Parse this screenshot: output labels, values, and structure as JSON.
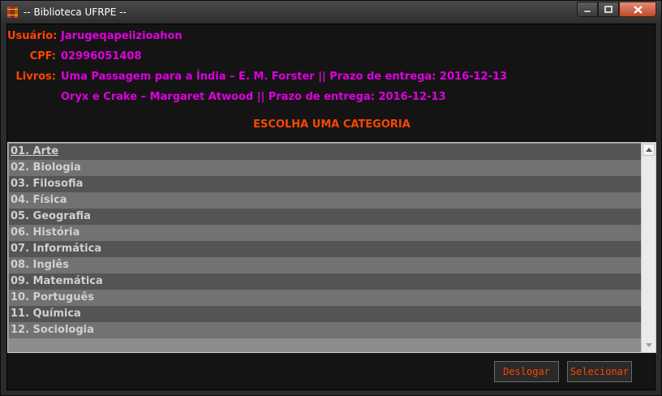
{
  "window": {
    "title": "-- Biblioteca UFRPE --",
    "minimize_icon": "minimize-icon",
    "maximize_icon": "maximize-icon",
    "close_icon": "close-icon"
  },
  "user": {
    "usuario_label": "Usuário:",
    "usuario_value": "Jarugeqapeiizioahon",
    "cpf_label": "CPF:",
    "cpf_value": "02996051408",
    "livros_label": "Livros:",
    "livros": [
      "Uma Passagem para a Índia – E. M. Forster || Prazo de entrega: 2016-12-13",
      "Oryx e Crake – Margaret Atwood || Prazo de entrega: 2016-12-13"
    ]
  },
  "heading": "ESCOLHA UMA CATEGORIA",
  "categories": [
    "01. Arte",
    "02. Biologia",
    "03. Filosofia",
    "04. Física",
    "05. Geografia",
    "06. História",
    "07. Informática",
    "08. Inglês",
    "09. Matemática",
    "10. Português",
    "11. Química",
    "12. Sociologia"
  ],
  "buttons": {
    "logout": "Deslogar",
    "select": "Selecionar"
  },
  "colors": {
    "label_orange": "#ff4500",
    "value_magenta": "#e000e0"
  }
}
